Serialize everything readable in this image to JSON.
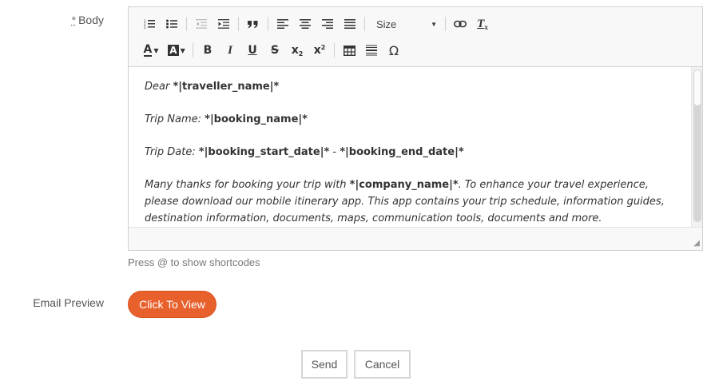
{
  "form": {
    "body_required_mark": "*",
    "body_label": "Body",
    "preview_label": "Email Preview",
    "hint": "Press @ to show shortcodes",
    "view_button": "Click To View",
    "send_button": "Send",
    "cancel_button": "Cancel"
  },
  "toolbar": {
    "size_label": "Size",
    "text_color_glyph": "A",
    "bg_color_glyph": "A",
    "bold": "B",
    "italic": "I",
    "underline": "U",
    "strike": "S",
    "subscript_base": "x",
    "subscript_mark": "2",
    "superscript_base": "x",
    "superscript_mark": "2",
    "special_char": "Ω",
    "clear_format_glyph": "T",
    "clear_format_mark": "x",
    "blockquote": "❞"
  },
  "content": {
    "line1_prefix": "Dear ",
    "line1_code": " *|traveller_name|*",
    "line2_prefix": "Trip Name: ",
    "line2_code": "*|booking_name|*",
    "line3_prefix": "Trip Date: ",
    "line3_code1": "*|booking_start_date|*",
    "line3_sep": " - ",
    "line3_code2": "*|booking_end_date|*",
    "para_prefix": "Many thanks for booking your trip with ",
    "para_code": "*|company_name|*",
    "para_rest": ". To enhance your travel experience, please download our mobile itinerary app. This app contains your trip schedule, information guides, destination information, documents, maps, communication tools, documents and more."
  },
  "colors": {
    "accent": "#e8602c"
  }
}
